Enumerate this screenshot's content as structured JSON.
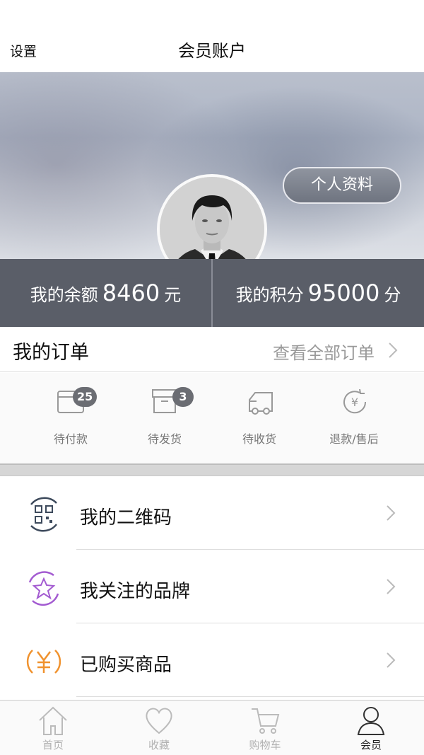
{
  "header": {
    "settings_label": "设置",
    "title": "会员账户"
  },
  "banner": {
    "profile_button": "个人资料",
    "gender_symbol": "♂"
  },
  "balance": {
    "balance_label": "我的余额",
    "balance_value": "8460",
    "balance_unit": "元",
    "points_label": "我的积分",
    "points_value": "95000",
    "points_unit": "分"
  },
  "orders": {
    "title": "我的订单",
    "view_all": "查看全部订单",
    "items": [
      {
        "label": "待付款",
        "badge": "25",
        "icon": "wallet-icon"
      },
      {
        "label": "待发货",
        "badge": "3",
        "icon": "box-icon"
      },
      {
        "label": "待收货",
        "badge": "",
        "icon": "truck-icon"
      },
      {
        "label": "退款/售后",
        "badge": "",
        "icon": "refund-icon"
      }
    ]
  },
  "menu": [
    {
      "label": "我的二维码",
      "icon": "qr-code-icon",
      "color": "#3d4a5c"
    },
    {
      "label": "我关注的品牌",
      "icon": "star-icon",
      "color": "#a35bd1"
    },
    {
      "label": "已购买商品",
      "icon": "yen-icon",
      "color": "#f0922e"
    }
  ],
  "tabs": [
    {
      "label": "首页",
      "icon": "home-icon"
    },
    {
      "label": "收藏",
      "icon": "heart-icon"
    },
    {
      "label": "购物车",
      "icon": "cart-icon"
    },
    {
      "label": "会员",
      "icon": "user-icon",
      "active": true
    }
  ]
}
